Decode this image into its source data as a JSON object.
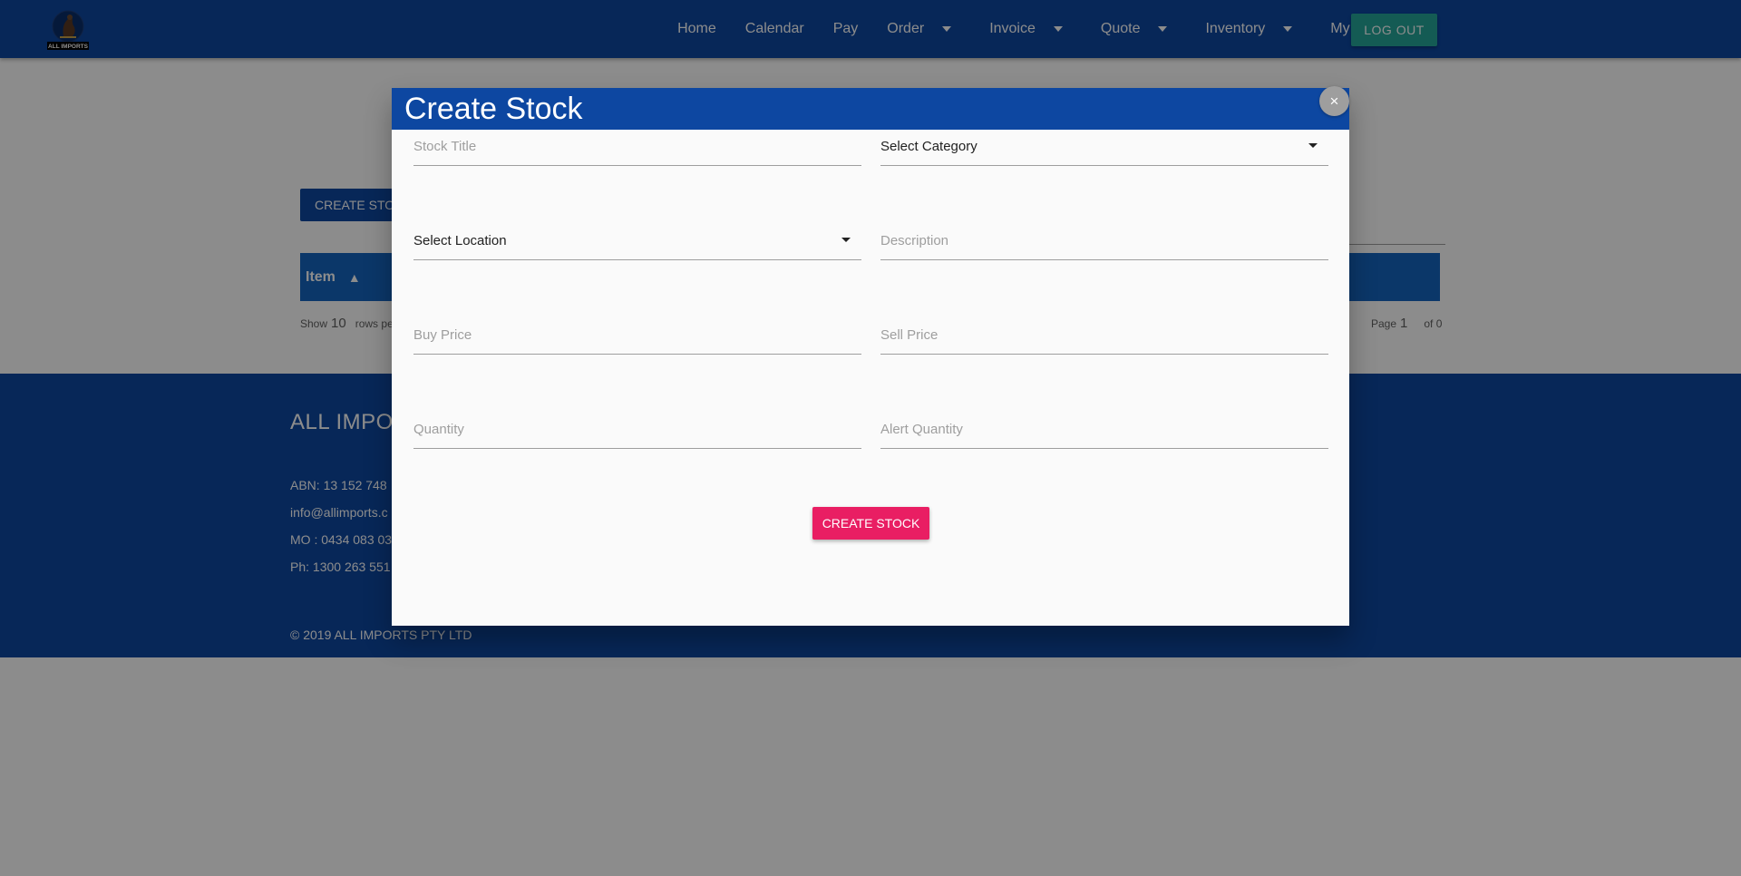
{
  "navbar": {
    "logo_text": "ALL IMPORTS",
    "links": [
      {
        "label": "Home"
      },
      {
        "label": "Calendar"
      },
      {
        "label": "Pay"
      },
      {
        "label": "Order"
      },
      {
        "label": "Invoice"
      },
      {
        "label": "Quote"
      },
      {
        "label": "Inventory"
      },
      {
        "label": "My Account"
      }
    ],
    "logout_label": "LOG OUT"
  },
  "page": {
    "create_button_label": "CREATE STOC",
    "table_header_first": "Item",
    "pager": {
      "show": "Show",
      "rows_value": "10",
      "rows_suffix": "rows pe",
      "page_label": "Page",
      "page_value": "1",
      "of_label": "of 0"
    }
  },
  "footer": {
    "title": "ALL IMPOR",
    "abn": "ABN: 13 152 748",
    "email": "info@allimports.c",
    "mobile": "MO : 0434 083 03",
    "phone": "Ph: 1300 263 551",
    "copyright": "© 2019 ALL IMPORTS PTY LTD"
  },
  "modal": {
    "title": "Create Stock",
    "close_symbol": "×",
    "fields": {
      "stock_title_placeholder": "Stock Title",
      "category_label": "Select Category",
      "location_label": "Select Location",
      "description_placeholder": "Description",
      "buy_price_placeholder": "Buy Price",
      "sell_price_placeholder": "Sell Price",
      "quantity_placeholder": "Quantity",
      "alert_quantity_placeholder": "Alert Quantity"
    },
    "submit_label": "CREATE STOCK"
  },
  "colors": {
    "primary": "#0d47a1",
    "table_header": "#1565c0",
    "logout": "#26a69a",
    "submit": "#e91e63"
  }
}
